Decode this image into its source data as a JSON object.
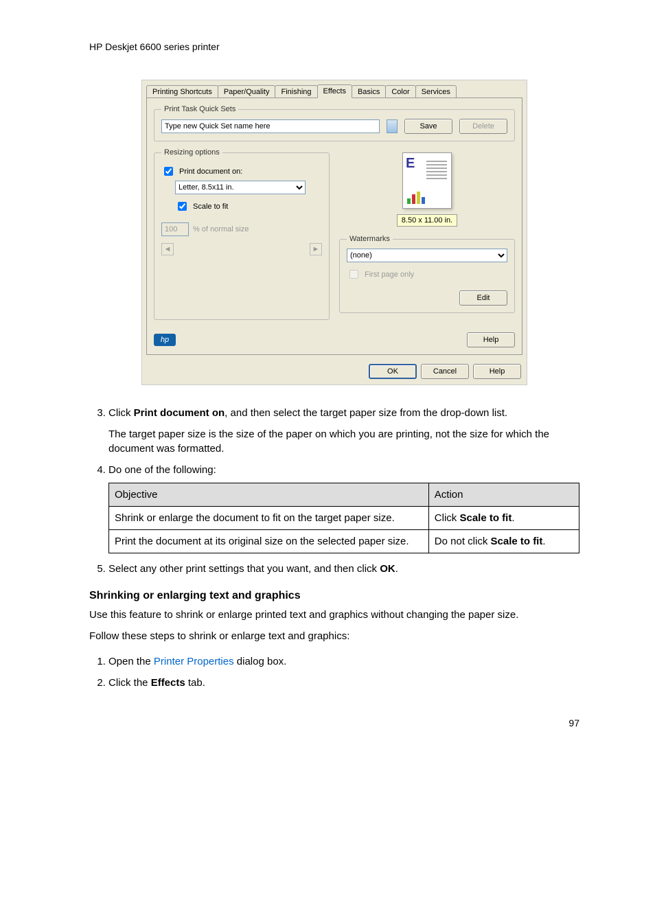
{
  "header": "HP Deskjet 6600 series printer",
  "dialog": {
    "tabs": [
      "Printing Shortcuts",
      "Paper/Quality",
      "Finishing",
      "Effects",
      "Basics",
      "Color",
      "Services"
    ],
    "active_tab": 3,
    "quickset": {
      "legend": "Print Task Quick Sets",
      "value": "Type new Quick Set name here",
      "save": "Save",
      "delete": "Delete"
    },
    "resizing": {
      "legend": "Resizing options",
      "print_doc_on": "Print document on:",
      "paper_select": "Letter, 8.5x11 in.",
      "scale_to_fit": "Scale to fit",
      "percent_value": "100",
      "percent_label": "% of normal size"
    },
    "preview": {
      "size_text": "8.50 x 11.00 in."
    },
    "watermarks": {
      "legend": "Watermarks",
      "value": "(none)",
      "first_page": "First page only",
      "edit": "Edit"
    },
    "help": "Help",
    "ok": "OK",
    "cancel": "Cancel",
    "help2": "Help"
  },
  "steps": {
    "s3": {
      "prefix": "Click ",
      "bold": "Print document on",
      "rest": ", and then select the target paper size from the drop-down list.",
      "para": "The target paper size is the size of the paper on which you are printing, not the size for which the document was formatted."
    },
    "s4": "Do one of the following:",
    "table": {
      "h1": "Objective",
      "h2": "Action",
      "r1c1": "Shrink or enlarge the document to fit on the target paper size.",
      "r1c2_a": "Click ",
      "r1c2_b": "Scale to fit",
      "r1c2_c": ".",
      "r2c1": "Print the document at its original size on the selected paper size.",
      "r2c2_a": "Do not click ",
      "r2c2_b": "Scale to fit",
      "r2c2_c": "."
    },
    "s5_a": "Select any other print settings that you want, and then click ",
    "s5_b": "OK",
    "s5_c": "."
  },
  "section": {
    "heading": "Shrinking or enlarging text and graphics",
    "p1": "Use this feature to shrink or enlarge printed text and graphics without changing the paper size.",
    "p2": "Follow these steps to shrink or enlarge text and graphics:",
    "li1_a": "Open the ",
    "li1_link": "Printer Properties",
    "li1_b": " dialog box.",
    "li2_a": "Click the ",
    "li2_b": "Effects",
    "li2_c": " tab."
  },
  "page_number": "97"
}
